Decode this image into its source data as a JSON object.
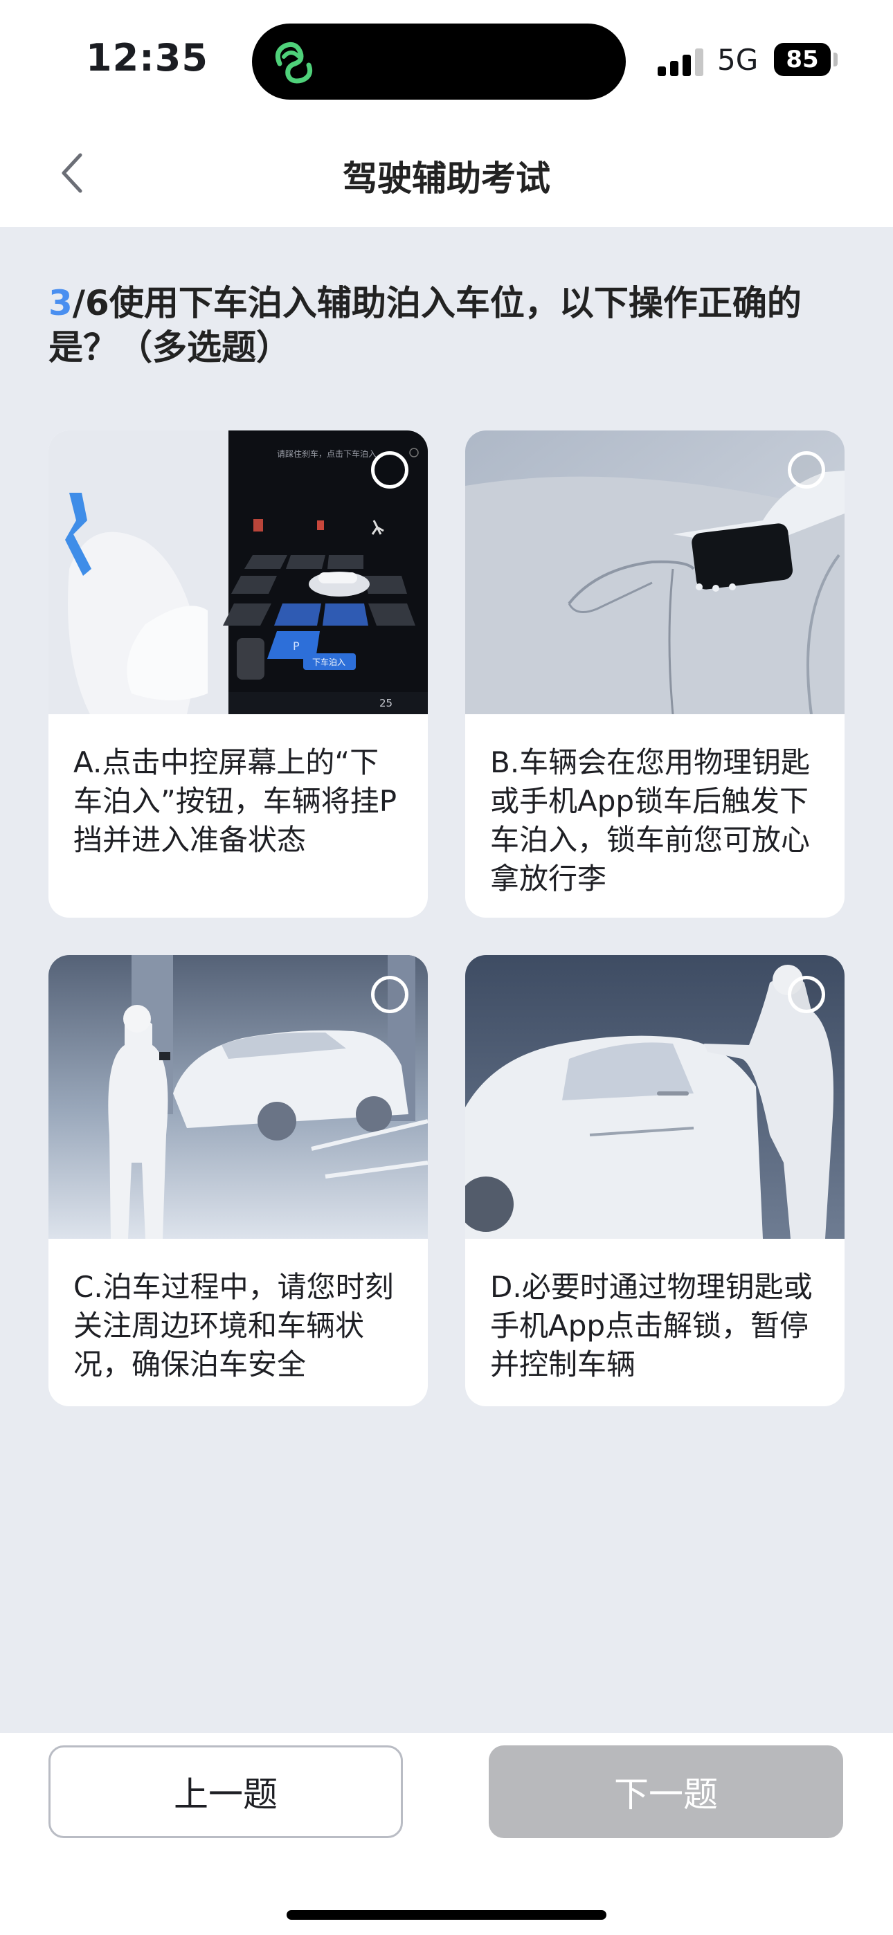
{
  "status_bar": {
    "time": "12:35",
    "network": "5G",
    "battery": "85"
  },
  "header": {
    "title": "驾驶辅助考试"
  },
  "question": {
    "current": "3",
    "total_text": "/6",
    "text": "使用下车泊入辅助泊入车位，以下操作正确的是？（多选题）"
  },
  "options": [
    {
      "text": "A.点击中控屏幕上的“下车泊入”按钮，车辆将挂P挡并进入准备状态",
      "selected": false
    },
    {
      "text": "B.车辆会在您用物理钥匙或手机App锁车后触发下车泊入，锁车前您可放心拿放行李",
      "selected": false
    },
    {
      "text": "C.泊车过程中，请您时刻关注周边环境和车辆状况，确保泊车安全",
      "selected": false
    },
    {
      "text": "D.必要时通过物理钥匙或手机App点击解锁，暂停并控制车辆",
      "selected": false
    }
  ],
  "screen_in_image_A": {
    "prompt": "请踩住刹车，点击下车泊入",
    "button": "下车泊入",
    "temperature": "25"
  },
  "footer": {
    "prev_label": "上一题",
    "next_label": "下一题"
  },
  "colors": {
    "accent": "#4a8ff0",
    "disabled_button": "#b8b9bc",
    "background": "#e8ebf1"
  }
}
